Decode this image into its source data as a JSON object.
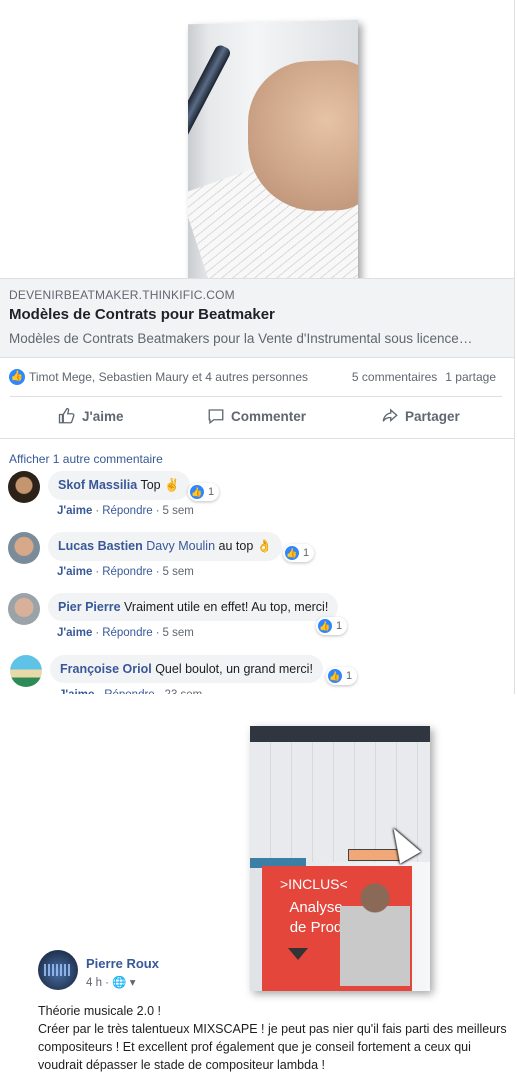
{
  "link": {
    "domain": "DEVENIRBEATMAKER.THINKIFIC.COM",
    "title": "Modèles de Contrats pour Beatmaker",
    "description": "Modèles de Contrats Beatmakers pour la Vente d'Instrumental sous licence…"
  },
  "reactions": {
    "names": "Timot Mege, Sebastien Maury et 4 autres personnes",
    "comments": "5 commentaires",
    "shares": "1 partage"
  },
  "actions": {
    "like": "J'aime",
    "comment": "Commenter",
    "share": "Partager"
  },
  "more_comments": "Afficher 1 autre commentaire",
  "comments": [
    {
      "name": "Skof Massilia",
      "tag": "",
      "text": "Top ✌",
      "likes": "1",
      "like_label": "J'aime",
      "reply_label": "Répondre",
      "time": "5 sem"
    },
    {
      "name": "Lucas Bastien",
      "tag": "Davy Moulin",
      "text": "au top 👌",
      "likes": "1",
      "like_label": "J'aime",
      "reply_label": "Répondre",
      "time": "5 sem"
    },
    {
      "name": "Pier Pierre",
      "tag": "",
      "text": "Vraiment utile en effet! Au top, merci!",
      "likes": "1",
      "like_label": "J'aime",
      "reply_label": "Répondre",
      "time": "5 sem"
    },
    {
      "name": "Françoise Oriol",
      "tag": "",
      "text": "Quel boulot, un grand merci!",
      "likes": "1",
      "like_label": "J'aime",
      "reply_label": "Répondre",
      "time": "23 sem"
    }
  ],
  "promo": {
    "inclus": ">INCLUS<",
    "analyse": "Analyse de Prod"
  },
  "post": {
    "author": "Pierre Roux",
    "time": "4 h ·",
    "lines": [
      "Théorie musicale 2.0 !",
      "Créer par le très talentueux MIXSCAPE !  je peut pas nier qu'il fais parti des meilleurs compositeurs ! Et excellent prof également que je conseil fortement a ceux qui voudrait dépasser le stade de compositeur lambda !"
    ]
  },
  "colors": {
    "link_blue": "#385898",
    "like_blue": "#2d88ff",
    "promo_red": "#e4463b"
  }
}
